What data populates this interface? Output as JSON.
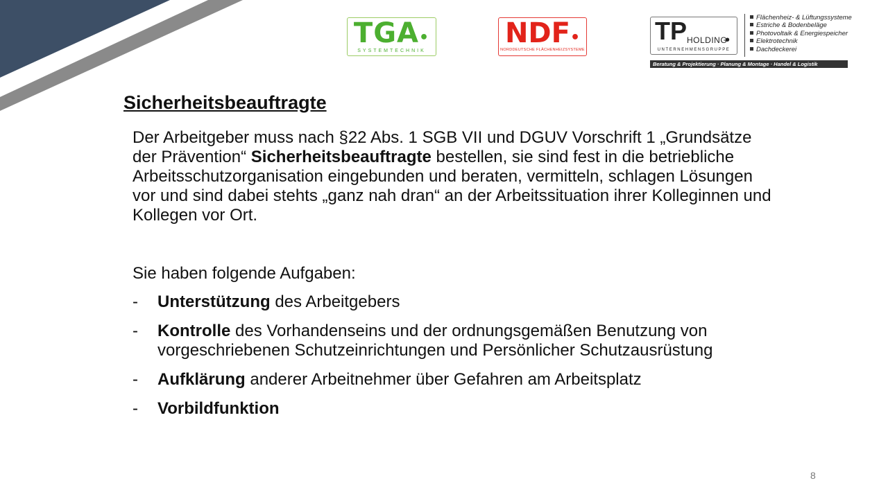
{
  "logos": {
    "tga": {
      "mark": "TGA",
      "sub": "SYSTEMTECHNIK",
      "color": "#4caf30"
    },
    "ndf": {
      "mark": "NDF",
      "sub": "NORDDEUTSCHE FLÄCHENHEIZSYSTEME",
      "color": "#e2231a"
    },
    "tp": {
      "mark": "TP",
      "holding": "HOLDING",
      "sub": "UNTERNEHMENSGRUPPE",
      "services": [
        "Flächenheiz- & Lüftungssysteme",
        "Estriche & Bodenbeläge",
        "Photovoltaik & Energiespeicher",
        "Elektrotechnik",
        "Dachdeckerei"
      ],
      "tagline": "Beratung & Projektierung · Planung & Montage · Handel & Logistik"
    }
  },
  "slide": {
    "title": "Sicherheitsbeauftragte",
    "intro_before": "Der Arbeitgeber muss nach §22 Abs. 1 SGB VII und DGUV Vorschrift 1 „Grundsätze der Prävention“ ",
    "intro_bold": "Sicherheitsbeauftragte",
    "intro_after": " bestellen, sie sind fest in die betriebliche Arbeitsschutzorganisation eingebunden und beraten, vermitteln, schlagen Lösungen vor und sind dabei stehts „ganz nah dran“ an der Arbeitssituation ihrer Kolleginnen und Kollegen vor Ort.",
    "tasks_heading": "Sie haben folgende Aufgaben:",
    "bullet": "-",
    "tasks": [
      {
        "bold": "Unterstützung",
        "rest": " des Arbeitgebers"
      },
      {
        "bold": "Kontrolle",
        "rest": " des Vorhandenseins und der ordnungsgemäßen Benutzung von vorgeschriebenen Schutzeinrichtungen und Persönlicher Schutzausrüstung"
      },
      {
        "bold": "Aufklärung",
        "rest": " anderer Arbeitnehmer über Gefahren am Arbeitsplatz"
      },
      {
        "bold": "Vorbildfunktion",
        "rest": ""
      }
    ],
    "page_number": "8"
  },
  "colors": {
    "corner_dark": "#3d4f66",
    "corner_stripe": "#8a8a8a"
  }
}
